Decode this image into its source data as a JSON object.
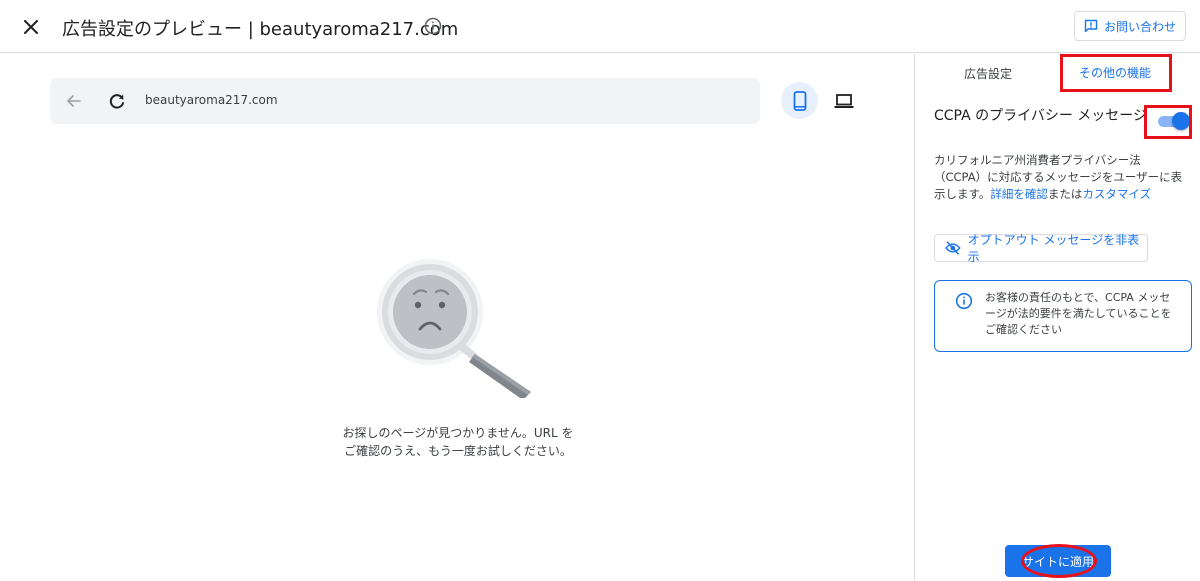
{
  "header": {
    "title": "広告設定のプレビュー | beautyaroma217.com",
    "close_icon": "close-icon",
    "info_icon": "info-icon",
    "contact_label": "お問い合わせ",
    "contact_icon": "feedback-icon"
  },
  "preview": {
    "url": "beautyaroma217.com",
    "back_icon": "arrow-back-icon",
    "reload_icon": "reload-icon",
    "device_mobile_icon": "smartphone-icon",
    "device_desktop_icon": "laptop-icon",
    "selected_device": "mobile",
    "not_found_line1": "お探しのページが見つかりません。URL を",
    "not_found_line2": "ご確認のうえ、もう一度お試しください。"
  },
  "panel": {
    "tabs": [
      {
        "label": "広告設定",
        "selected": false
      },
      {
        "label": "その他の機能",
        "selected": true
      }
    ],
    "ccpa_title": "CCPA のプライバシー メッセージ",
    "ccpa_toggle_on": true,
    "ccpa_desc_prefix": "カリフォルニア州消費者プライバシー法（CCPA）に対応するメッセージをユーザーに表示します。",
    "ccpa_link_details": "詳細を確認",
    "ccpa_desc_or": "または",
    "ccpa_link_customize": "カスタマイズ",
    "hide_optout_label": "オプトアウト メッセージを非表示",
    "hide_optout_icon": "visibility-off-icon",
    "notice_text": "お客様の責任のもとで、CCPA メッセージが法的要件を満たしていることをご確認ください",
    "notice_icon": "info-icon",
    "apply_label": "サイトに適用"
  },
  "colors": {
    "accent": "#1a73e8",
    "annotation_red": "#e8111b",
    "border": "#dadce0"
  }
}
